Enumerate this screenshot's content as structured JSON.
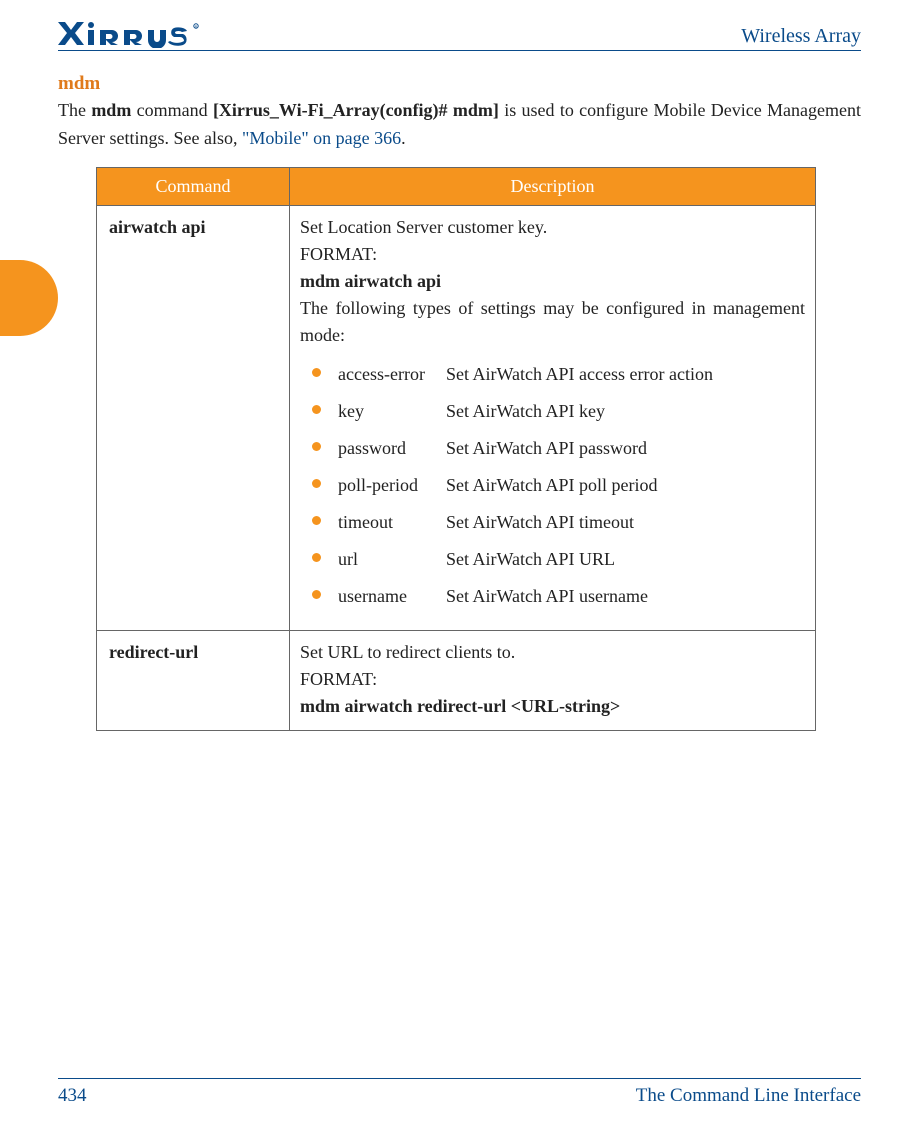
{
  "header": {
    "logo_text": "XIRRUS",
    "doc_title": "Wireless Array"
  },
  "section": {
    "title": "mdm",
    "intro_prefix": "The ",
    "intro_cmd": "mdm",
    "intro_mid": " command ",
    "intro_prompt": "[Xirrus_Wi-Fi_Array(config)# mdm]",
    "intro_suffix": " is used to configure Mobile Device Management Server settings. See also, ",
    "intro_link": "\"Mobile\" on page 366",
    "intro_end": "."
  },
  "table": {
    "headers": {
      "command": "Command",
      "description": "Description"
    },
    "rows": [
      {
        "command": "airwatch api",
        "desc_line": " Set Location Server customer key.",
        "format_label": "FORMAT:",
        "format_cmd": "mdm airwatch api",
        "after_format": "The following types of settings may be configured in management mode:",
        "settings": [
          {
            "term": "access-error",
            "def": "Set AirWatch API access error action"
          },
          {
            "term": "key",
            "def": "Set AirWatch API key"
          },
          {
            "term": "password",
            "def": "Set AirWatch API password"
          },
          {
            "term": "poll-period",
            "def": "Set AirWatch API poll period"
          },
          {
            "term": "timeout",
            "def": "Set AirWatch API timeout"
          },
          {
            "term": "url",
            "def": "Set AirWatch API URL"
          },
          {
            "term": "username",
            "def": "Set AirWatch API username"
          }
        ]
      },
      {
        "command": "redirect-url",
        "desc_line": " Set URL to redirect clients to.",
        "format_label": "FORMAT:",
        "format_cmd": "mdm airwatch redirect-url <URL-string>"
      }
    ]
  },
  "footer": {
    "page_number": "434",
    "section_title": "The Command Line Interface"
  }
}
